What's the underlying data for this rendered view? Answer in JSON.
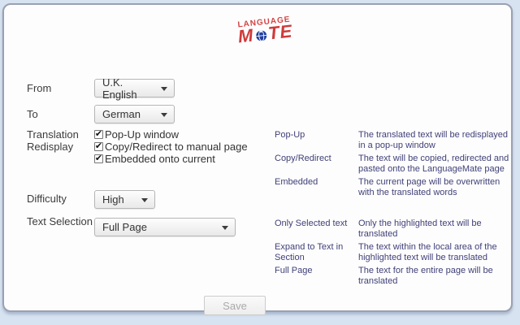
{
  "logo": {
    "line1": "LANGUAGE",
    "m_part": "M",
    "te_part": "TE"
  },
  "form": {
    "from": {
      "label": "From",
      "value": "U.K. English"
    },
    "to": {
      "label": "To",
      "value": "German"
    },
    "translation_redisplay": {
      "label": "Translation Redisplay",
      "options": [
        {
          "label": "Pop-Up window",
          "checked": true
        },
        {
          "label": "Copy/Redirect to manual page",
          "checked": true
        },
        {
          "label": "Embedded onto current",
          "checked": true
        }
      ]
    },
    "difficulty": {
      "label": "Difficulty",
      "value": "High"
    },
    "text_selection": {
      "label": "Text Selection",
      "value": "Full Page"
    }
  },
  "help": {
    "redisplay": [
      {
        "term": "Pop-Up",
        "desc": "The translated text will be redisplayed in a pop-up window"
      },
      {
        "term": "Copy/Redirect",
        "desc": "The text will be copied, redirected and pasted onto the LanguageMate page"
      },
      {
        "term": "Embedded",
        "desc": "The current page will be overwritten with the translated words"
      }
    ],
    "selection": [
      {
        "term": "Only Selected text",
        "desc": "Only the highlighted text will be translated"
      },
      {
        "term": "Expand to Text in Section",
        "desc": "The text within the local area of the highlighted text will be translated"
      },
      {
        "term": "Full Page",
        "desc": "The text for the entire page will be translated"
      }
    ]
  },
  "save_label": "Save",
  "icons": {
    "checkmark": "✔"
  },
  "colors": {
    "page_bg": "#d7e3f0",
    "panel_border": "#9aa1b2",
    "logo_red": "#cf3a3a",
    "globe_blue": "#1e3f9e",
    "help_text": "#414178"
  }
}
